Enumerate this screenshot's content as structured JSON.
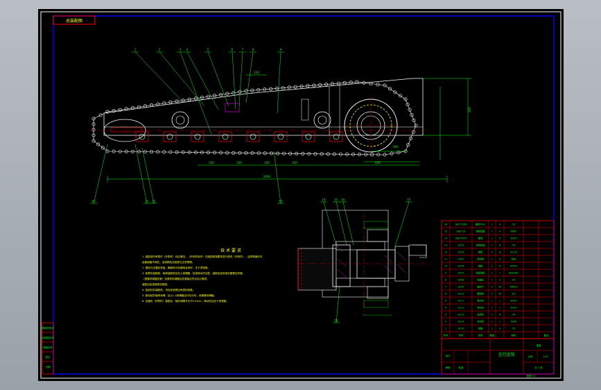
{
  "drawing": {
    "top_tag": "总装配图",
    "title_cn": "左行走轮",
    "sheet_no": "图号 11",
    "tech_heading": "技 术 要 求",
    "tech_notes": [
      "1. 装配前所有零件（外购件）均应清洗，（外购件除外）在装配前按要求进行清洗（外购件），油漆厚度均匀",
      "   齿面接触不良处，油漆颜色及各部位注意清理。",
      "2. 链轮与支重轮安装，确保轮与轨链啮合良好，无卡滞现象。",
      "3. 各零件装配前，轴承装配前应加入润滑脂，检查转动灵活性，装配后检查密封圈是否完整。",
      "   （按要求调整张紧）张紧机构调整后张紧量应符合设计要求，",
      "   装配后检查链条松紧度。",
      "4. 各密封件装配前，均应检查是否有损伤现象。",
      "5. 驱动轮的轴承润滑，加入L-2润滑脂应均匀分布，用锂基润滑脂。",
      "6. 支重轮（外购件）装配后，轴向间隙不大于0.5mm，转动灵活无卡滞现象。"
    ],
    "balloons_top": [
      "1",
      "2",
      "3",
      "4",
      "5",
      "6",
      "7",
      "8",
      "9"
    ],
    "balloons_bottom": [
      "10",
      "11",
      "12",
      "13",
      "14",
      "15",
      "16",
      "17",
      "18"
    ],
    "dims": [
      "150",
      "200",
      "500",
      "1850",
      "2600",
      "650",
      "110"
    ],
    "bom_rows": [
      [
        "16",
        "GB/T 5783",
        "螺栓 M10",
        "1",
        "4",
        "35",
        "",
        ""
      ],
      [
        "15",
        "GB/T 93",
        "弹簧垫圈",
        "1",
        "4",
        "65Mn",
        "",
        ""
      ],
      [
        "14",
        "GB/T 6170",
        "螺母",
        "1",
        "8",
        "Q235",
        "",
        ""
      ],
      [
        "13",
        "JX-03",
        "支重轮轴",
        "1",
        "6",
        "45",
        "",
        ""
      ],
      [
        "12",
        "JX-04",
        "轴承",
        "2",
        "12",
        "GCr15",
        "",
        ""
      ],
      [
        "11",
        "JX-05",
        "密封圈",
        "1",
        "6",
        "NBR",
        "",
        ""
      ],
      [
        "10",
        "JX-06",
        "端盖",
        "1",
        "6",
        "HT200",
        "",
        ""
      ],
      [
        "9",
        "JX-07",
        "张紧弹簧",
        "1",
        "1",
        "60Si2Mn",
        "",
        ""
      ],
      [
        "8",
        "JX-08",
        "托链轮",
        "1",
        "2",
        "45",
        "",
        ""
      ],
      [
        "7",
        "JX-09",
        "链轨节",
        "2",
        "40",
        "40Mn2",
        "",
        ""
      ],
      [
        "6",
        "JX-10",
        "履带板",
        "1",
        "40",
        "ZG",
        "",
        ""
      ],
      [
        "5",
        "JX-11",
        "驱动轮",
        "1",
        "1",
        "ZG35",
        "",
        ""
      ],
      [
        "4",
        "JX-12",
        "导向轮",
        "1",
        "1",
        "ZG35",
        "",
        ""
      ],
      [
        "3",
        "JX-13",
        "支重轮",
        "1",
        "6",
        "45",
        "",
        ""
      ],
      [
        "2",
        "JX-14",
        "台车架",
        "1",
        "1",
        "Q345",
        "",
        ""
      ],
      [
        "1",
        "JX-15",
        "销轴",
        "1",
        "4",
        "45",
        "",
        ""
      ]
    ],
    "bom_header": [
      "序号",
      "代号",
      "名称",
      "数量",
      "",
      "材料",
      "",
      "备注"
    ],
    "title_block": {
      "scale_label": "比例",
      "scale": "1:10",
      "weight_label": "重量",
      "sheet_label": "共 1 张",
      "designer_label": "设计",
      "checker_label": "审核",
      "approve_label": "批准"
    },
    "left_block": [
      "借用件登记",
      "旧底图总号",
      "底图总号",
      "签字",
      "日期"
    ],
    "colors": {
      "frame": "#ffffff",
      "red": "#ff0000",
      "green": "#00ff00",
      "yellow": "#ffff00",
      "cyan": "#00ffff",
      "blue": "#0000ff",
      "magenta": "#ff00ff",
      "white": "#ffffff"
    }
  }
}
